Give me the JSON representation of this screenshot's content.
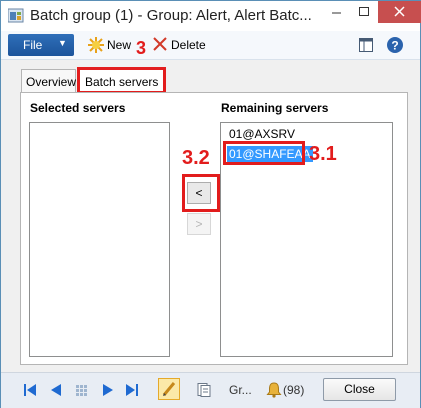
{
  "window": {
    "title": "Batch group (1) - Group: Alert, Alert Batc..."
  },
  "toolbar": {
    "file_label": "File",
    "new_label": "New",
    "delete_label": "Delete"
  },
  "tabs": [
    {
      "label": "Overview"
    },
    {
      "label": "Batch servers"
    }
  ],
  "panel": {
    "selected_label": "Selected servers",
    "remaining_label": "Remaining servers",
    "selected_servers": [],
    "remaining_servers": [
      "01@AXSRV",
      "01@SHAFEAA"
    ],
    "move_left_label": "<",
    "move_right_label": ">"
  },
  "annotations": {
    "new_step": "3",
    "list_step": "3.1",
    "button_step": "3.2"
  },
  "statusbar": {
    "group_text": "Gr...",
    "alerts_count": "(98)",
    "close_label": "Close"
  },
  "colors": {
    "annotation": "#e21c1c",
    "selection": "#3399ff",
    "file_button": "#2360a8"
  }
}
